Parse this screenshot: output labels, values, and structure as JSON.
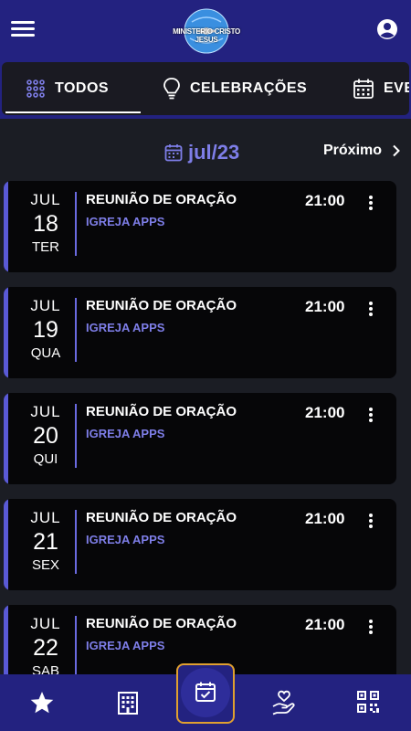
{
  "header": {
    "menu_icon": "hamburger-menu-icon",
    "logo_text": "MINISTERIO CRISTO JESUS",
    "account_icon": "account-circle-icon"
  },
  "tabs": [
    {
      "label": "TODOS",
      "icon": "grid-dots-icon",
      "active": true
    },
    {
      "label": "CELEBRAÇÕES",
      "icon": "lightbulb-icon",
      "active": false
    },
    {
      "label": "EVE",
      "icon": "calendar-icon",
      "active": false
    }
  ],
  "month_nav": {
    "current": "jul/23",
    "next_label": "Próximo",
    "next_icon": "chevron-right-icon"
  },
  "events": [
    {
      "month": "JUL",
      "day": "18",
      "weekday": "TER",
      "title": "REUNIÃO DE ORAÇÃO",
      "org": "IGREJA APPS",
      "time": "21:00"
    },
    {
      "month": "JUL",
      "day": "19",
      "weekday": "QUA",
      "title": "REUNIÃO DE ORAÇÃO",
      "org": "IGREJA APPS",
      "time": "21:00"
    },
    {
      "month": "JUL",
      "day": "20",
      "weekday": "QUI",
      "title": "REUNIÃO DE ORAÇÃO",
      "org": "IGREJA APPS",
      "time": "21:00"
    },
    {
      "month": "JUL",
      "day": "21",
      "weekday": "SEX",
      "title": "REUNIÃO DE ORAÇÃO",
      "org": "IGREJA APPS",
      "time": "21:00"
    },
    {
      "month": "JUL",
      "day": "22",
      "weekday": "SAB",
      "title": "REUNIÃO DE ORAÇÃO",
      "org": "IGREJA APPS",
      "time": "21:00"
    }
  ],
  "bottom_nav": [
    {
      "icon": "star-icon",
      "active": false
    },
    {
      "icon": "building-icon",
      "active": false
    },
    {
      "icon": "calendar-check-icon",
      "active": true
    },
    {
      "icon": "hand-heart-icon",
      "active": false
    },
    {
      "icon": "qr-code-icon",
      "active": false
    }
  ],
  "colors": {
    "primary": "#232280",
    "accent": "#7e7ee8",
    "background": "#1b1d24",
    "card": "#060608",
    "active_border": "#e0a030"
  }
}
